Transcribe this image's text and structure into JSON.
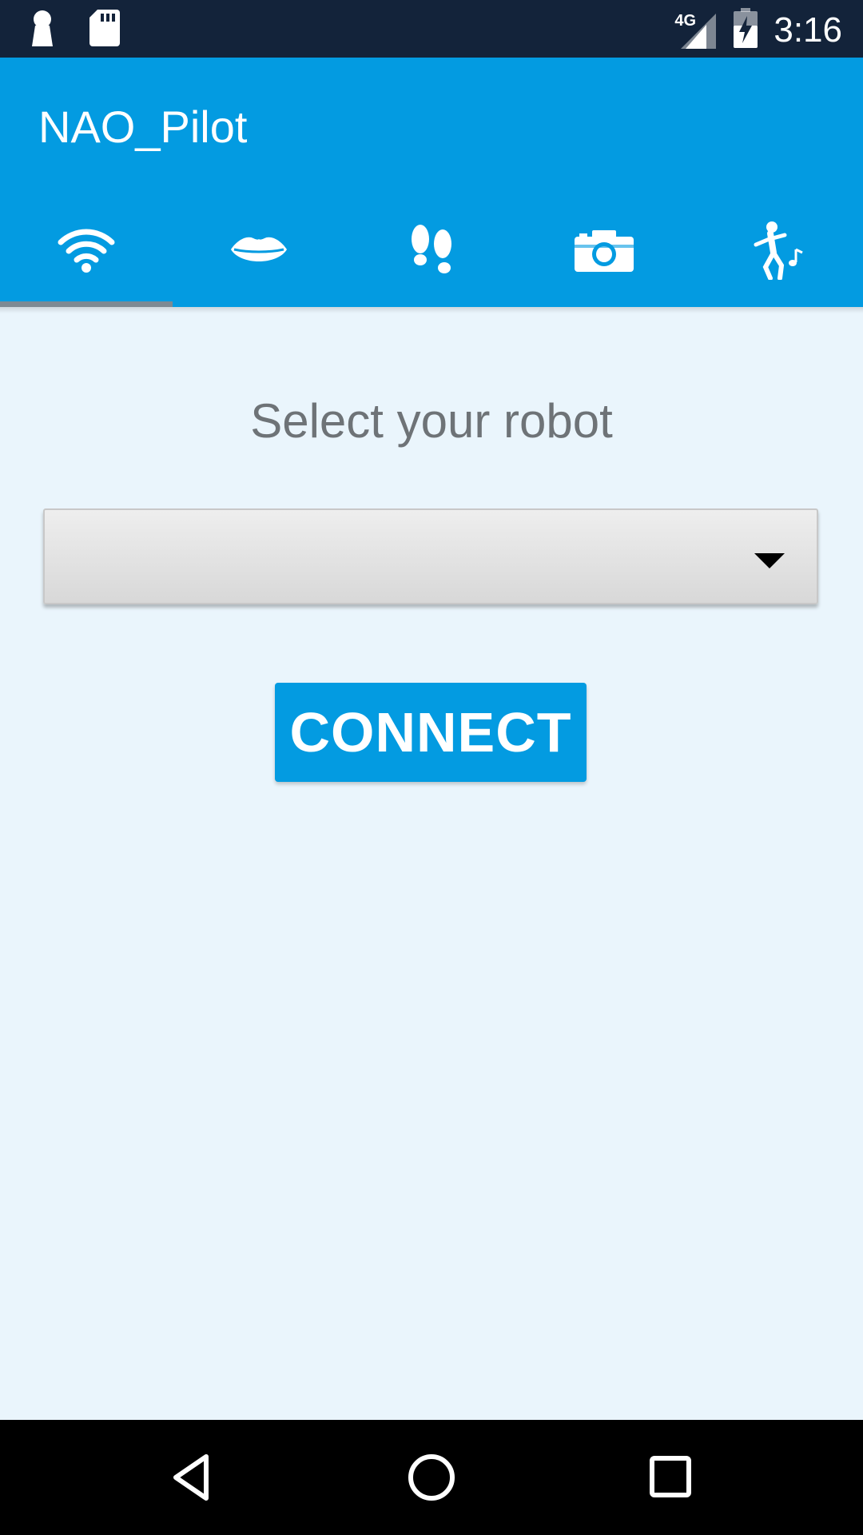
{
  "status_bar": {
    "network": "4G",
    "time": "3:16",
    "icons": [
      "keyhole-icon",
      "sd-card-icon",
      "signal-icon",
      "battery-charging-icon"
    ]
  },
  "app": {
    "title": "NAO_Pilot",
    "accent_color": "#039BE1"
  },
  "tabs": [
    {
      "icon": "wifi-icon",
      "selected": true
    },
    {
      "icon": "lips-icon",
      "selected": false
    },
    {
      "icon": "footprints-icon",
      "selected": false
    },
    {
      "icon": "camera-icon",
      "selected": false
    },
    {
      "icon": "dancing-person-icon",
      "selected": false
    }
  ],
  "main": {
    "prompt": "Select your robot",
    "robot_select_value": "",
    "connect_label": "CONNECT"
  },
  "nav_bar": {
    "icons": [
      "back-icon",
      "home-icon",
      "recents-icon"
    ]
  }
}
